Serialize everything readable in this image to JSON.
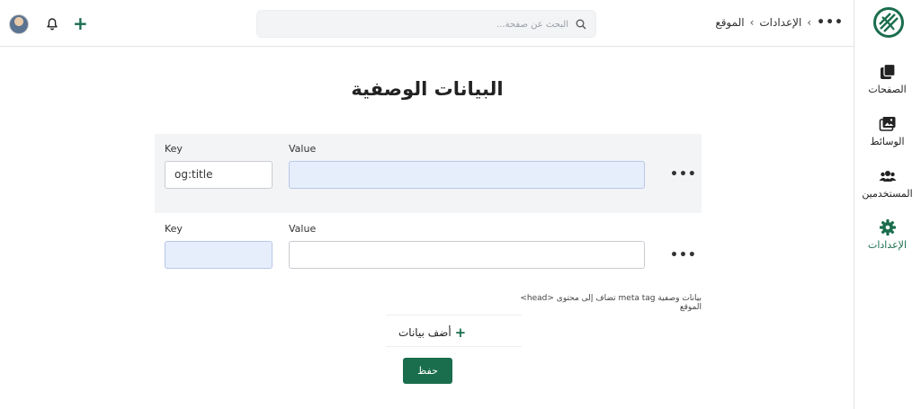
{
  "colors": {
    "brand": "#1a6e4d",
    "row_bg": "#f3f4f6",
    "input_highlight": "#e6eefc"
  },
  "header": {
    "breadcrumb": {
      "more": "•••",
      "items": [
        "الإعدادات",
        "الموقع"
      ]
    },
    "search": {
      "placeholder": "البحث عن صفحة..."
    },
    "actions": {
      "add": "+"
    }
  },
  "sidebar": {
    "items": [
      {
        "label": "الصفحات",
        "icon": "pages-icon"
      },
      {
        "label": "الوسائط",
        "icon": "media-icon"
      },
      {
        "label": "المستخدمين",
        "icon": "users-icon"
      },
      {
        "label": "الإعدادات",
        "icon": "gear-icon",
        "active": true
      }
    ]
  },
  "main": {
    "title": "البيانات الوصفية",
    "rows": [
      {
        "key_label": "Key",
        "value_label": "Value",
        "key_value": "og:title",
        "value_value": "",
        "more": "•••"
      },
      {
        "key_label": "Key",
        "value_label": "Value",
        "key_value": "",
        "value_value": "",
        "more": "•••"
      }
    ],
    "helper": "بيانات وصفية meta tag تضاف إلى محتوى <head> الموقع",
    "add_label": "أضف بيانات",
    "add_plus": "+",
    "save_label": "حفظ"
  }
}
